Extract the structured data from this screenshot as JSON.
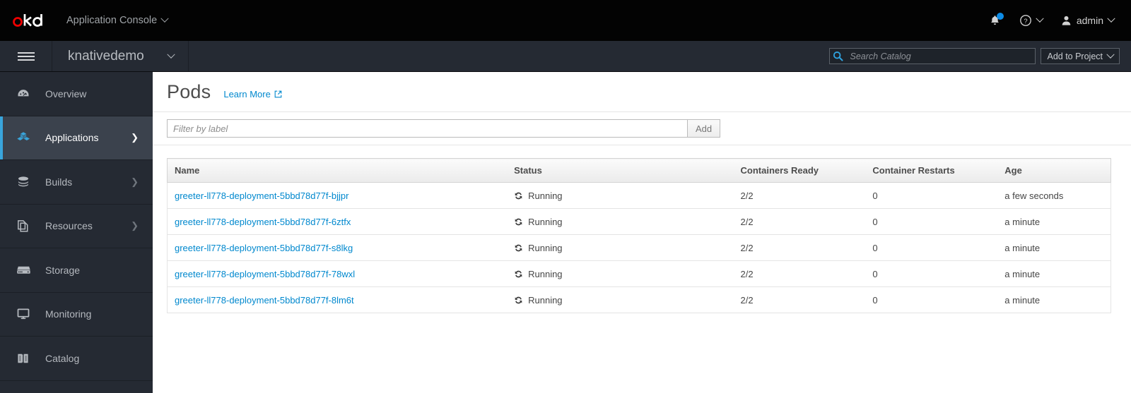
{
  "masthead": {
    "logo_alt": "okd",
    "console_label": "Application Console",
    "notifications_icon": "bell-icon",
    "help_icon": "help-circle-icon",
    "user_icon": "user-icon",
    "user_label": "admin",
    "accent_blue": "#0d8ce6",
    "background": "#030303"
  },
  "projectbar": {
    "menu_icon": "hamburger-icon",
    "project_name": "knativedemo",
    "search_placeholder": "Search Catalog",
    "search_value": "",
    "search_icon": "search-icon",
    "add_to_project_label": "Add to Project",
    "background": "#252a33"
  },
  "sidebar": {
    "active_accent": "#39a5dc",
    "items": [
      {
        "label": "Overview",
        "icon": "dashboard-icon",
        "has_chevron": false,
        "active": false
      },
      {
        "label": "Applications",
        "icon": "cubes-icon",
        "has_chevron": true,
        "active": true
      },
      {
        "label": "Builds",
        "icon": "layers-icon",
        "has_chevron": true,
        "active": false
      },
      {
        "label": "Resources",
        "icon": "copy-files-icon",
        "has_chevron": true,
        "active": false
      },
      {
        "label": "Storage",
        "icon": "storage-icon",
        "has_chevron": false,
        "active": false
      },
      {
        "label": "Monitoring",
        "icon": "monitor-icon",
        "has_chevron": false,
        "active": false
      },
      {
        "label": "Catalog",
        "icon": "book-icon",
        "has_chevron": false,
        "active": false
      }
    ]
  },
  "main": {
    "page_title": "Pods",
    "learn_more_label": "Learn More",
    "learn_more_icon": "external-link-icon",
    "filter_placeholder": "Filter by label",
    "filter_value": "",
    "filter_add_label": "Add",
    "table": {
      "columns": [
        "Name",
        "Status",
        "Containers Ready",
        "Container Restarts",
        "Age"
      ],
      "status_icon": "sync-icon",
      "rows": [
        {
          "name": "greeter-ll778-deployment-5bbd78d77f-bjjpr",
          "status": "Running",
          "containers_ready": "2/2",
          "container_restarts": "0",
          "age": "a few seconds"
        },
        {
          "name": "greeter-ll778-deployment-5bbd78d77f-6ztfx",
          "status": "Running",
          "containers_ready": "2/2",
          "container_restarts": "0",
          "age": "a minute"
        },
        {
          "name": "greeter-ll778-deployment-5bbd78d77f-s8lkg",
          "status": "Running",
          "containers_ready": "2/2",
          "container_restarts": "0",
          "age": "a minute"
        },
        {
          "name": "greeter-ll778-deployment-5bbd78d77f-78wxl",
          "status": "Running",
          "containers_ready": "2/2",
          "container_restarts": "0",
          "age": "a minute"
        },
        {
          "name": "greeter-ll778-deployment-5bbd78d77f-8lm6t",
          "status": "Running",
          "containers_ready": "2/2",
          "container_restarts": "0",
          "age": "a minute"
        }
      ]
    }
  }
}
